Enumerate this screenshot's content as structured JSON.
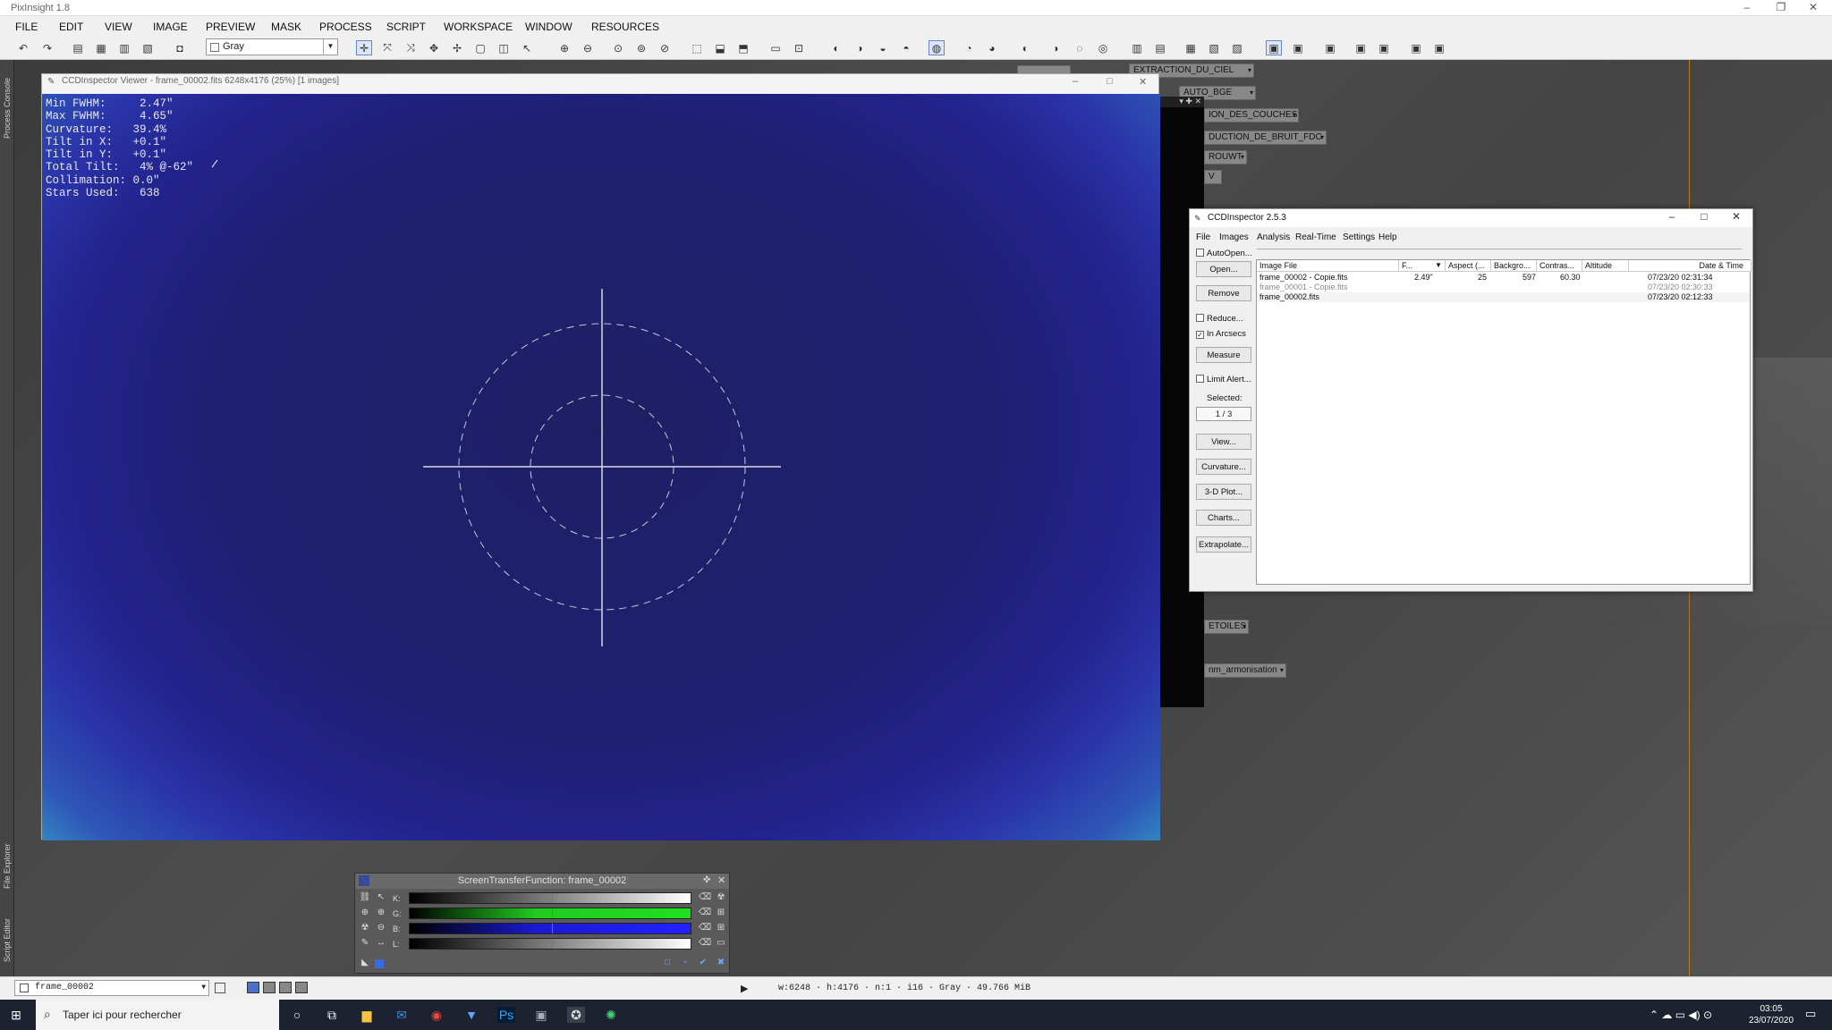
{
  "app": {
    "title": "PixInsight 1.8"
  },
  "menu": [
    "FILE",
    "EDIT",
    "VIEW",
    "IMAGE",
    "PREVIEW",
    "MASK",
    "PROCESS",
    "SCRIPT",
    "WORKSPACE",
    "WINDOW",
    "RESOURCES"
  ],
  "toolbar": {
    "color_select": "Gray"
  },
  "left_rail": {
    "process_console": "Process Console",
    "file_explorer": "File Explorer",
    "script_editor": "Script Editor"
  },
  "desktop_icons": [
    "EXTRACTION_DU_CIEL",
    "AUTO_BGE",
    "ION_DES_COUCHES",
    "DUCTION_DE_BRUIT_FDC",
    "ROUWT",
    "V",
    "ETOILES",
    "nm_armonisation"
  ],
  "viewer": {
    "title": "CCDInspector Viewer - frame_00002.fits 6248x4176 (25%) [1 images]",
    "overlay": [
      "Min FWHM:     2.47\"",
      "Max FWHM:     4.65\"",
      "Curvature:   39.4%",
      "Tilt in X:   +0.1\"",
      "Tilt in Y:   +0.1\"",
      "Total Tilt:   4% @-62\"",
      "Collimation: 0.0\"",
      "Stars Used:   638"
    ]
  },
  "ccd": {
    "title": "CCDInspector 2.5.3",
    "menu": [
      "File",
      "Images",
      "Analysis",
      "Real-Time",
      "Settings",
      "Help"
    ],
    "autoopen": "AutoOpen...",
    "open": "Open...",
    "remove": "Remove",
    "reduce": "Reduce...",
    "in_arcsecs": "In Arcsecs",
    "measure": "Measure",
    "limit_alert": "Limit Alert...",
    "selected_label": "Selected:",
    "selected_value": "1 / 3",
    "view": "View...",
    "curvature": "Curvature...",
    "plot3d": "3-D Plot...",
    "charts": "Charts...",
    "extrapolate": "Extrapolate...",
    "columns": [
      "Image File",
      "F...",
      "Aspect (...",
      "Backgro...",
      "Contras...",
      "Altitude",
      "Date & Time"
    ],
    "rows": [
      {
        "file": "frame_00002 - Copie.fits",
        "fwhm": "2.49\"",
        "aspect": "25",
        "bg": "597",
        "contrast": "60.30",
        "alt": "",
        "date": "07/23/20 02:31:34"
      },
      {
        "file": "frame_00001 - Copie.fits",
        "fwhm": "",
        "aspect": "",
        "bg": "",
        "contrast": "",
        "alt": "",
        "date": "07/23/20 02:30:33"
      },
      {
        "file": "frame_00002.fits",
        "fwhm": "",
        "aspect": "",
        "bg": "",
        "contrast": "",
        "alt": "",
        "date": "07/23/20 02:12:33"
      }
    ]
  },
  "stf": {
    "title": "ScreenTransferFunction: frame_00002",
    "channels": [
      "K:",
      "G:",
      "B:",
      "L:"
    ]
  },
  "status": {
    "view": "frame_00002",
    "info": "w:6248 · h:4176 · n:1 · i16 · Gray · 49.766 MiB"
  },
  "taskbar": {
    "search": "Taper ici pour rechercher",
    "time": "03:05",
    "date": "23/07/2020"
  },
  "colors": {
    "accent_orange": "#c07a20",
    "taskbar": "#1c2230"
  }
}
